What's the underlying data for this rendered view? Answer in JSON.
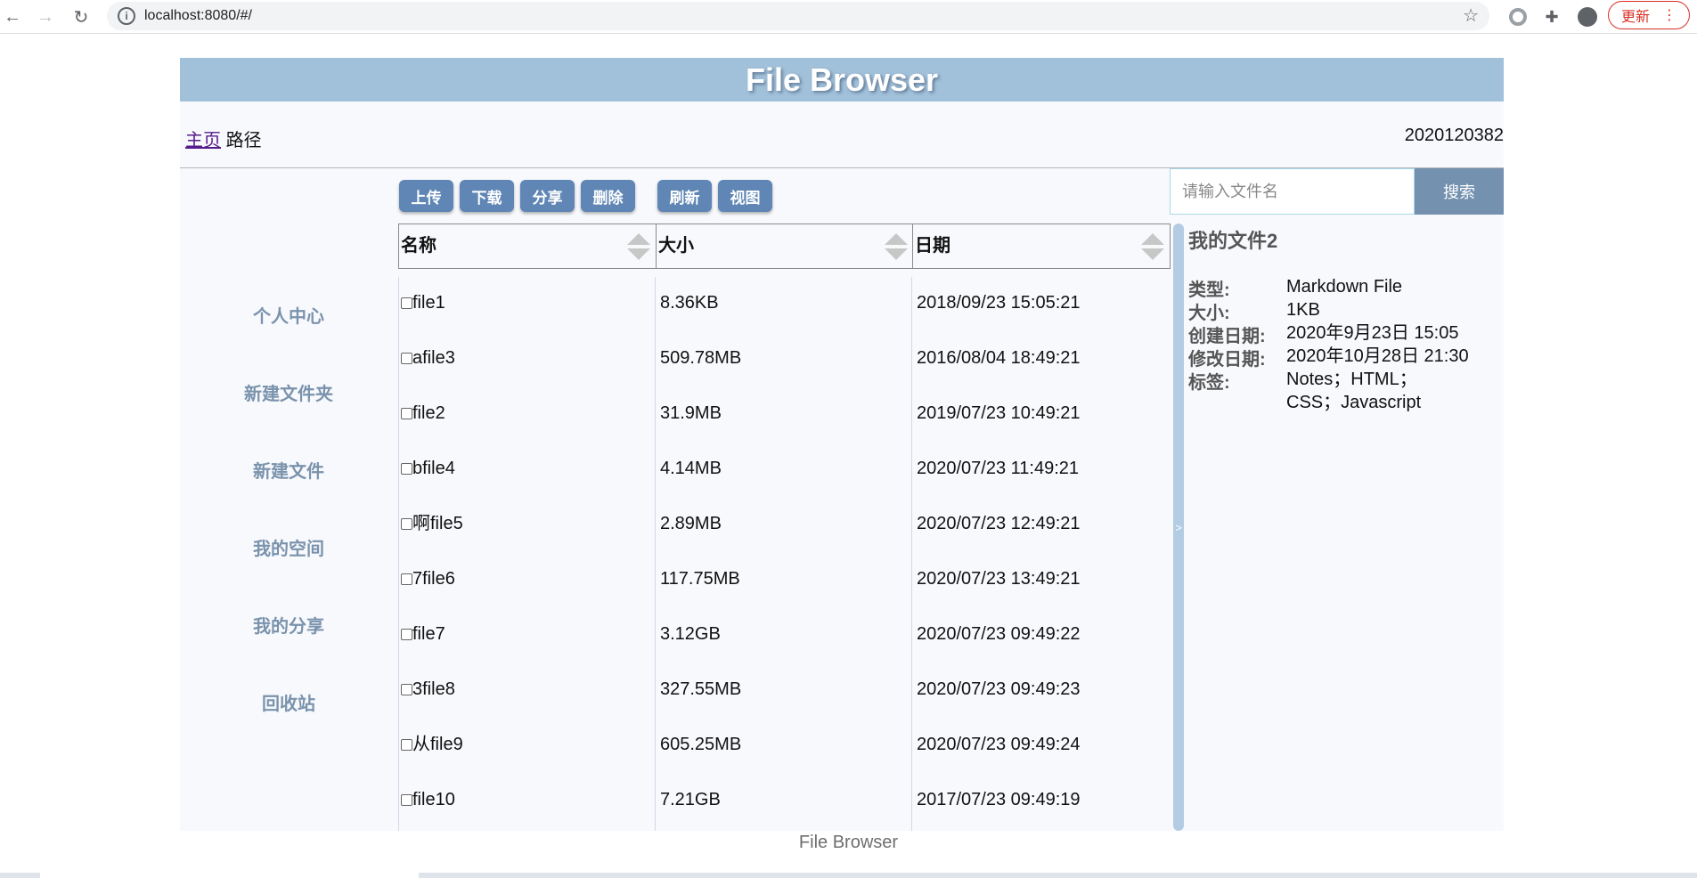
{
  "browser": {
    "url": "localhost:8080/#/",
    "update_label": "更新"
  },
  "app": {
    "title": "File Browser",
    "breadcrumb": {
      "home": "主页",
      "path": "路径"
    },
    "user_id": "2020120382",
    "footer": "File Browser"
  },
  "sidebar": {
    "items": [
      {
        "label": "个人中心"
      },
      {
        "label": "新建文件夹"
      },
      {
        "label": "新建文件"
      },
      {
        "label": "我的空间"
      },
      {
        "label": "我的分享"
      },
      {
        "label": "回收站"
      }
    ]
  },
  "toolbar": {
    "buttons": [
      {
        "label": "上传"
      },
      {
        "label": "下载"
      },
      {
        "label": "分享"
      },
      {
        "label": "删除"
      },
      {
        "label": "刷新"
      },
      {
        "label": "视图"
      }
    ]
  },
  "table": {
    "headers": {
      "name": "名称",
      "size": "大小",
      "date": "日期"
    },
    "rows": [
      {
        "name": "file1",
        "size": "8.36KB",
        "date": "2018/09/23 15:05:21"
      },
      {
        "name": "afile3",
        "size": "509.78MB",
        "date": "2016/08/04 18:49:21"
      },
      {
        "name": "file2",
        "size": "31.9MB",
        "date": "2019/07/23 10:49:21"
      },
      {
        "name": "bfile4",
        "size": "4.14MB",
        "date": "2020/07/23 11:49:21"
      },
      {
        "name": "啊file5",
        "size": "2.89MB",
        "date": "2020/07/23 12:49:21"
      },
      {
        "name": "7file6",
        "size": "117.75MB",
        "date": "2020/07/23 13:49:21"
      },
      {
        "name": "file7",
        "size": "3.12GB",
        "date": "2020/07/23 09:49:22"
      },
      {
        "name": "3file8",
        "size": "327.55MB",
        "date": "2020/07/23 09:49:23"
      },
      {
        "name": "从file9",
        "size": "605.25MB",
        "date": "2020/07/23 09:49:24"
      },
      {
        "name": "file10",
        "size": "7.21GB",
        "date": "2017/07/23 09:49:19"
      }
    ]
  },
  "search": {
    "placeholder": "请输入文件名",
    "button": "搜索"
  },
  "divider_glyph": ">",
  "details": {
    "title": "我的文件2",
    "fields": [
      {
        "label": "类型:",
        "value": "Markdown File"
      },
      {
        "label": "大小:",
        "value": "1KB"
      },
      {
        "label": "创建日期:",
        "value": "2020年9月23日 15:05"
      },
      {
        "label": "修改日期:",
        "value": "2020年10月28日 21:30"
      },
      {
        "label": "标签:",
        "value": "Notes；HTML；CSS；Javascript"
      }
    ]
  }
}
